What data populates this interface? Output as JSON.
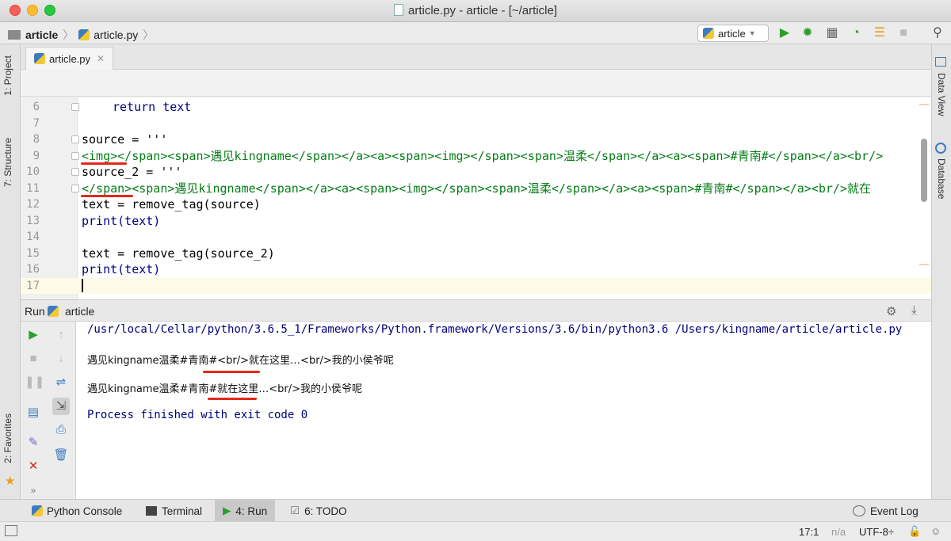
{
  "window": {
    "title": "article.py - article - [~/article]"
  },
  "navbar": {
    "breadcrumb": [
      "article",
      "article.py"
    ],
    "run_config": "article"
  },
  "left_tabs": {
    "project": "1: Project",
    "structure": "7: Structure",
    "favorites": "2: Favorites"
  },
  "right_tabs": {
    "data_view": "Data View",
    "database": "Database"
  },
  "editor": {
    "tab_label": "article.py",
    "lines": [
      {
        "n": "6",
        "pre": "    ",
        "text": "return text",
        "kind": "ret"
      },
      {
        "n": "7",
        "text": ""
      },
      {
        "n": "8",
        "text": "source = '''",
        "kind": "assign"
      },
      {
        "n": "9",
        "text": "<img></span><span>遇见kingname</span></a><a><span><img></span><span>温柔</span></a><a><span>#青南#</span></a><br/>",
        "kind": "str"
      },
      {
        "n": "10",
        "text": "source_2 = '''",
        "kind": "assign"
      },
      {
        "n": "11",
        "text": "</span><span>遇见kingname</span></a><a><span><img></span><span>温柔</span></a><a><span>#青南#</span></a><br/>就在",
        "kind": "str"
      },
      {
        "n": "12",
        "text": "text = remove_tag(source)"
      },
      {
        "n": "13",
        "text": "print(text)"
      },
      {
        "n": "14",
        "text": ""
      },
      {
        "n": "15",
        "text": "text = remove_tag(source_2)"
      },
      {
        "n": "16",
        "text": "print(text)"
      },
      {
        "n": "17",
        "text": ""
      }
    ]
  },
  "run": {
    "header_label": "Run",
    "config_name": "article",
    "output": [
      "/usr/local/Cellar/python/3.6.5_1/Frameworks/Python.framework/Versions/3.6/bin/python3.6 /Users/kingname/article/article.py",
      "遇见kingname温柔#青南#<br/>就在这里…<br/>我的小侯爷呢",
      "遇见kingname温柔#青南#就在这里…<br/>我的小侯爷呢",
      "Process finished with exit code 0"
    ]
  },
  "bottom_tabs": [
    "Python Console",
    "Terminal",
    "4: Run",
    "6: TODO"
  ],
  "event_log": "Event Log",
  "status": {
    "position": "17:1",
    "na": "n/a",
    "encoding": "UTF-8÷"
  },
  "colors": {
    "string": "#067d17",
    "keyword": "#000080",
    "annotation": "#e4281b"
  }
}
